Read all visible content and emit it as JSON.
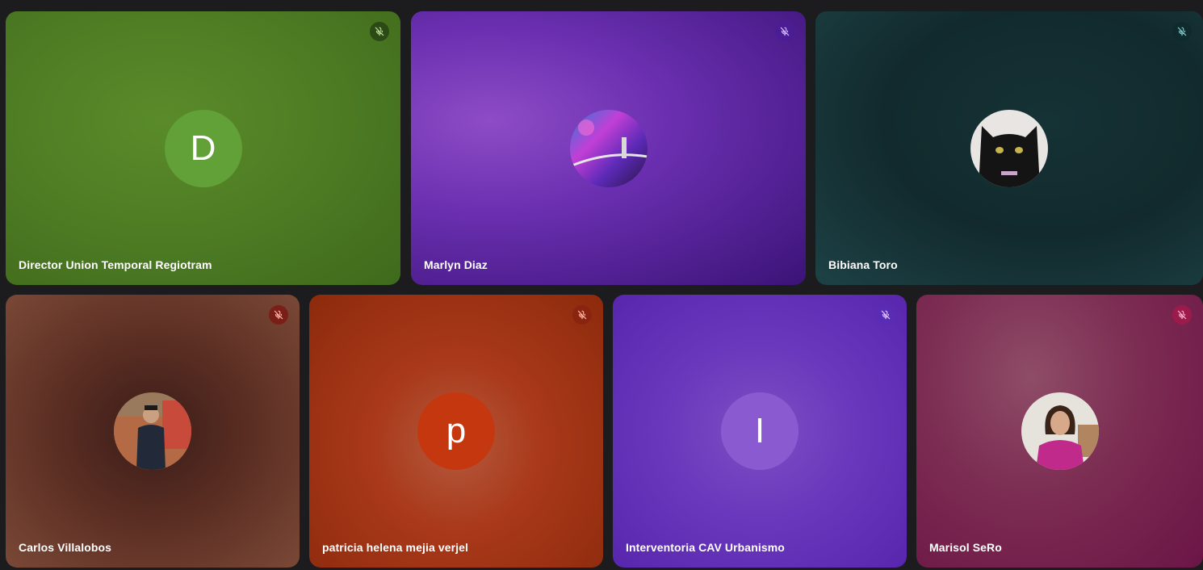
{
  "participants": [
    {
      "name": "Director Union Temporal Regiotram",
      "initial": "D",
      "avatar": "letter",
      "avatar_color": "#62a038",
      "mute_bg": "#2c4a16",
      "mic_state": "muted"
    },
    {
      "name": "Marlyn Diaz",
      "initial": "",
      "avatar": "photo",
      "mute_bg": "#4a1d95",
      "mic_state": "muted"
    },
    {
      "name": "Bibiana Toro",
      "initial": "",
      "avatar": "photo",
      "mute_bg": "#0e2a2c",
      "mic_state": "muted"
    },
    {
      "name": "Carlos Villalobos",
      "initial": "",
      "avatar": "photo",
      "mute_bg": "#7a1e18",
      "mic_state": "muted"
    },
    {
      "name": "patricia helena mejia verjel",
      "initial": "p",
      "avatar": "letter",
      "avatar_color": "#c5380f",
      "mute_bg": "#8a2410",
      "mic_state": "muted"
    },
    {
      "name": "Interventoria CAV Urbanismo",
      "initial": "I",
      "avatar": "letter",
      "avatar_color": "#8a5bd0",
      "mute_bg": "#5a2cb6",
      "mic_state": "muted"
    },
    {
      "name": "Marisol SeRo",
      "initial": "",
      "avatar": "photo",
      "mute_bg": "#9c1b4c",
      "mic_state": "muted"
    }
  ],
  "icons": {
    "mic_off": "mic-off-icon"
  }
}
